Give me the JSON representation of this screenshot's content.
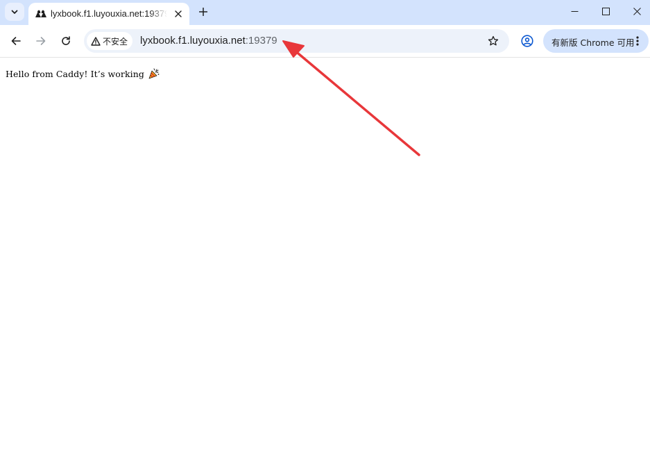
{
  "tab": {
    "title": "lyxbook.f1.luyouxia.net:19379"
  },
  "address_bar": {
    "security_label": "不安全",
    "url_host": "lyxbook.f1.luyouxia.net",
    "url_port": ":19379"
  },
  "update_chip": {
    "label": "有新版 Chrome 可用"
  },
  "page": {
    "text": "Hello from Caddy! It’s working"
  },
  "icons": {
    "tab_search": "chevron-down-icon",
    "favicon": "site-favicon",
    "tab_close": "close-icon",
    "new_tab": "plus-icon",
    "minimize": "minimize-icon",
    "maximize": "maximize-icon",
    "window_close": "close-icon",
    "back": "arrow-left-icon",
    "forward": "arrow-right-icon",
    "reload": "reload-icon",
    "warning": "warning-icon",
    "bookmark": "star-icon",
    "profile": "profile-icon",
    "menu": "more-vert-icon",
    "emoji": "party-popper-icon",
    "annotation": "red-arrow-annotation"
  },
  "colors": {
    "tabstrip_bg": "#d3e3fd",
    "omnibox_bg": "#edf2fa",
    "annotation_arrow": "#e8373a"
  }
}
